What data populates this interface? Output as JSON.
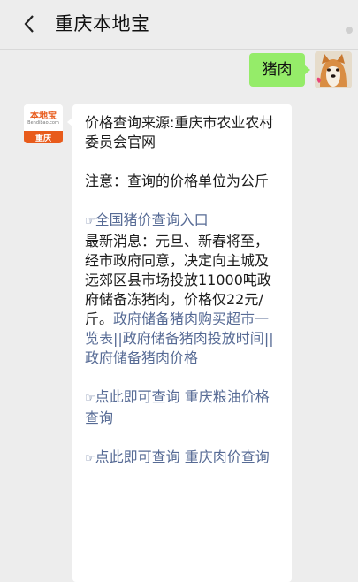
{
  "header": {
    "back_icon": "chevron-left-icon",
    "title": "重庆本地宝"
  },
  "outgoing": {
    "text": "猪肉",
    "bubble_color": "#95ec69",
    "avatar": "shiba-dog-avatar"
  },
  "incoming": {
    "avatar": {
      "logo_text": "本地宝",
      "logo_url": "Bendibao.com",
      "city": "重庆",
      "brand_color": "#e85b1b"
    },
    "source": "价格查询来源:重庆市农业农村委员会官网",
    "note": "注意：查询的价格单位为公斤",
    "hand_icon": "☞",
    "national_link": "全国猪价查询入口",
    "news_text": "最新消息：元旦、新春将至，经市政府同意，决定向主城及远郊区县市场投放11000吨政府储备冻猪肉，价格仅22元/斤。",
    "news_links": [
      "政府储备猪肉购买超市一览表",
      "政府储备猪肉投放时间",
      "政府储备猪肉价格"
    ],
    "separator": "||",
    "grain_link": "点此即可查询 重庆粮油价格查询",
    "meat_link": "点此即可查询 重庆肉价查询"
  },
  "colors": {
    "link": "#576b95",
    "background": "#ededed"
  }
}
